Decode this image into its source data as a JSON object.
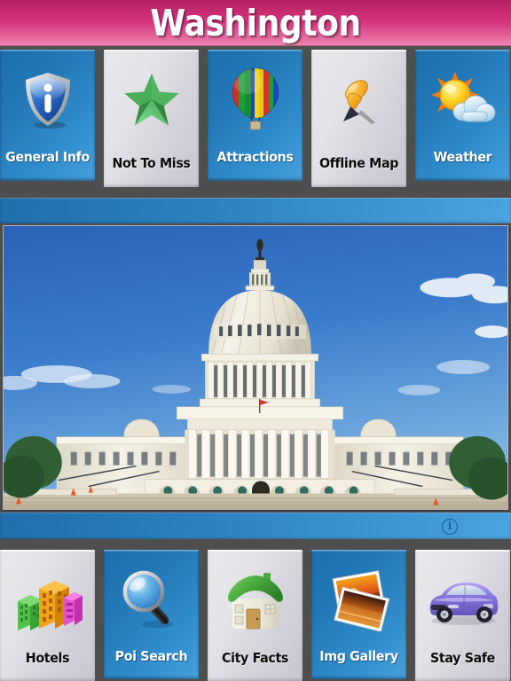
{
  "header": {
    "title": "Washington",
    "gradient_top": "#b01f5e",
    "gradient_bottom": "#ef86b2"
  },
  "theme": {
    "background": "#4e4e4e",
    "tile_blue": "#2a7fbe",
    "tile_white": "#e3e2e7",
    "band_blue": "#3a92d0",
    "label_light": "#ffffff",
    "label_dark": "#0c0c0c"
  },
  "top_row": {
    "tiles": [
      {
        "label": "General Info",
        "icon": "info-shield-icon",
        "style": "blue"
      },
      {
        "label": "Not To Miss",
        "icon": "green-star-icon",
        "style": "white"
      },
      {
        "label": "Attractions",
        "icon": "hot-air-balloon-icon",
        "style": "blue"
      },
      {
        "label": "Offline Map",
        "icon": "pushpin-icon",
        "style": "white"
      },
      {
        "label": "Weather",
        "icon": "sun-cloud-icon",
        "style": "blue"
      }
    ]
  },
  "bottom_row": {
    "tiles": [
      {
        "label": "Hotels",
        "icon": "buildings-icon",
        "style": "white"
      },
      {
        "label": "Poi Search",
        "icon": "magnifier-icon",
        "style": "blue"
      },
      {
        "label": "City Facts",
        "icon": "green-house-icon",
        "style": "white"
      },
      {
        "label": "Img Gallery",
        "icon": "photo-stack-icon",
        "style": "blue"
      },
      {
        "label": "Stay Safe",
        "icon": "purple-car-icon",
        "style": "white"
      }
    ]
  },
  "bands": {
    "upper": {
      "name": "upper-blue-band"
    },
    "lower": {
      "name": "lower-blue-band",
      "info_glyph": "i"
    }
  },
  "photo": {
    "name": "us-capitol-photo",
    "subject": "United States Capitol Building",
    "sky_color": "#2f6fc0",
    "building_color": "#f2efe4"
  }
}
